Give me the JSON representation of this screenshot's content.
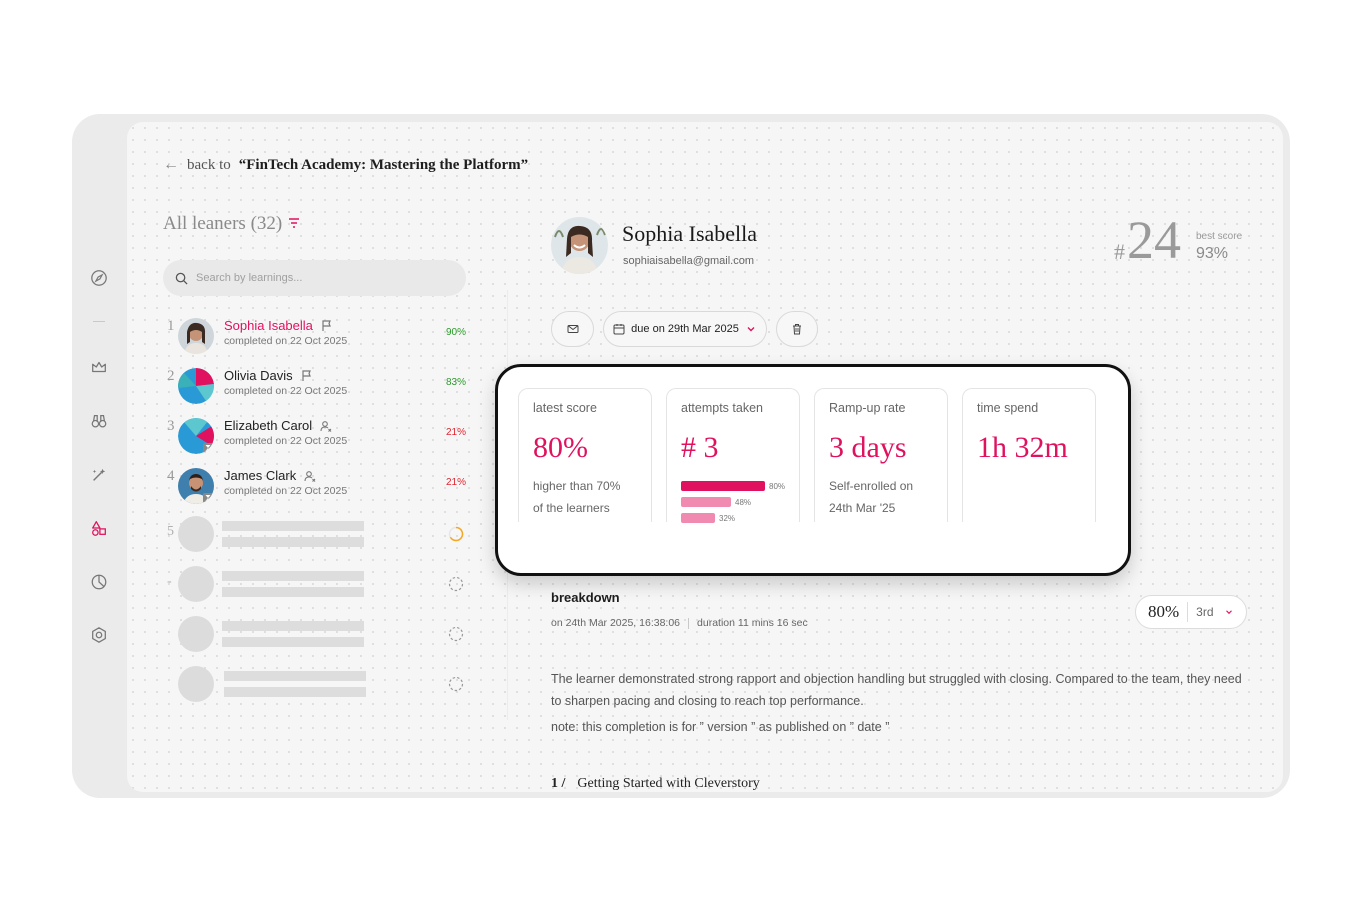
{
  "back_link": {
    "prefix": "back to",
    "course": "“FinTech Academy: Mastering the Platform”"
  },
  "learners": {
    "title": "All leaners (32)",
    "search_placeholder": "Search by learnings...",
    "rows": [
      {
        "rank": "1",
        "name": "Sophia Isabella",
        "date": "completed on 22 Oct 2025",
        "score": "90%"
      },
      {
        "rank": "2",
        "name": "Olivia Davis",
        "date": "completed on 22 Oct 2025",
        "score": "83%"
      },
      {
        "rank": "3",
        "name": "Elizabeth Carol",
        "date": "completed on 22 Oct 2025",
        "score": "21%"
      },
      {
        "rank": "4",
        "name": "James Clark",
        "date": "completed on 22 Oct 2025",
        "score": "21%"
      }
    ],
    "placeholder_ranks": [
      "5",
      "-"
    ]
  },
  "profile": {
    "name": "Sophia Isabella",
    "email": "sophiaisabella@gmail.com",
    "rank_hash": "#",
    "rank": "24",
    "best_score_label": "best score",
    "best_score": "93%"
  },
  "actions": {
    "due": "due on 29th Mar 2025"
  },
  "stats": {
    "latest_score": {
      "label": "latest score",
      "value": "80%",
      "sub1": "higher than 70%",
      "sub2": "of the learners"
    },
    "attempts": {
      "label": "attempts taken",
      "value": "# 3",
      "bars": [
        {
          "pct": 80,
          "label": "80%"
        },
        {
          "pct": 48,
          "label": "48%"
        },
        {
          "pct": 32,
          "label": "32%"
        }
      ]
    },
    "ramp_up": {
      "label": "Ramp-up rate",
      "value": "3 days",
      "sub1": "Self-enrolled on",
      "sub2": "24th Mar '25"
    },
    "time_spend": {
      "label": "time spend",
      "value": "1h 32m"
    }
  },
  "breakdown": {
    "title": "breakdown",
    "date": "on 24th Mar 2025, 16:38:06",
    "duration": "duration 11 mins 16 sec",
    "score": "80%",
    "place": "3rd",
    "summary": "The learner demonstrated strong rapport and objection handling but struggled with closing. Compared to the team, they need to sharpen pacing and closing to reach top performance.",
    "note": "note: this completion is for ” version ” as published on ” date ”",
    "section_number": "1 /",
    "section_title": "Getting Started with Cleverstory"
  },
  "colors": {
    "accent": "#e0115f",
    "accent_light": "#f08ab0",
    "green": "#2a9a2a",
    "red": "#e0252f"
  }
}
